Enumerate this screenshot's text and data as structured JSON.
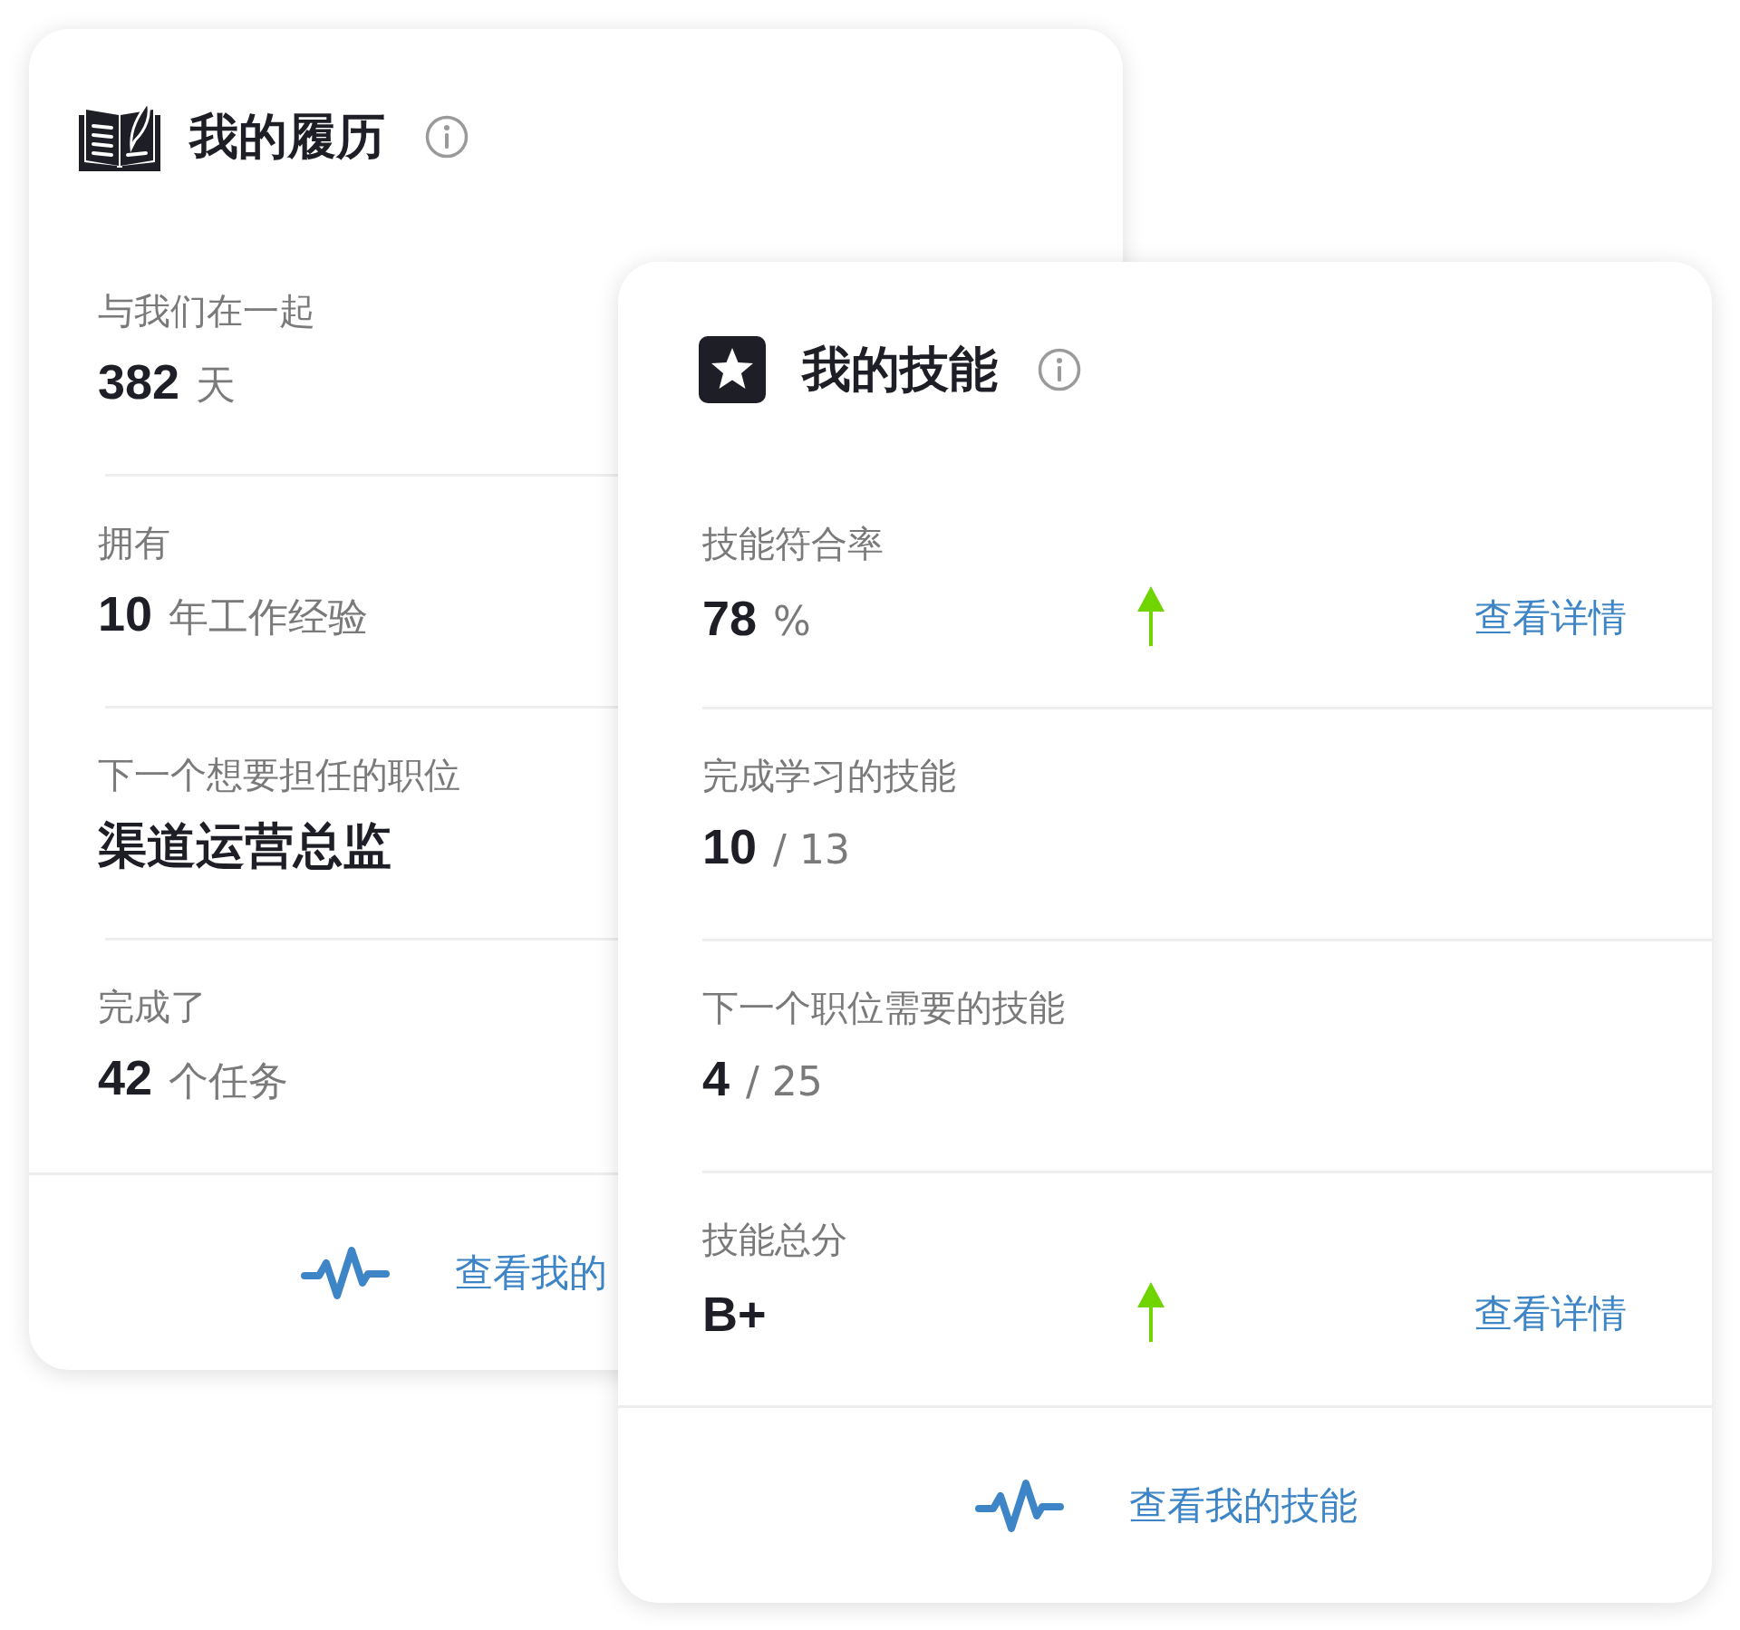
{
  "cards": [
    {
      "kind": "book",
      "title": "我的履历",
      "rows": [
        {
          "label": "与我们在一起",
          "value": "382",
          "unit": "天"
        },
        {
          "label": "拥有",
          "value": "10",
          "unit": "年工作经验"
        },
        {
          "label": "下一个想要担任的职位",
          "value": "渠道运营总监"
        },
        {
          "label": "完成了",
          "value": "42",
          "unit": "个任务"
        }
      ],
      "footer_link": "查看我的"
    },
    {
      "kind": "star",
      "title": "我的技能",
      "rows": [
        {
          "label": "技能符合率",
          "value": "78",
          "unit": "%",
          "rising": true,
          "link": "查看详情"
        },
        {
          "label": "完成学习的技能",
          "value": "10",
          "unit": "/ 13",
          "rising": false
        },
        {
          "label": "下一个职位需要的技能",
          "value": "4",
          "unit": "/ 25",
          "rising": false
        },
        {
          "label": "技能总分",
          "value": "B+",
          "rising": true,
          "link": "查看详情"
        }
      ],
      "footer_link": "查看我的技能"
    }
  ]
}
